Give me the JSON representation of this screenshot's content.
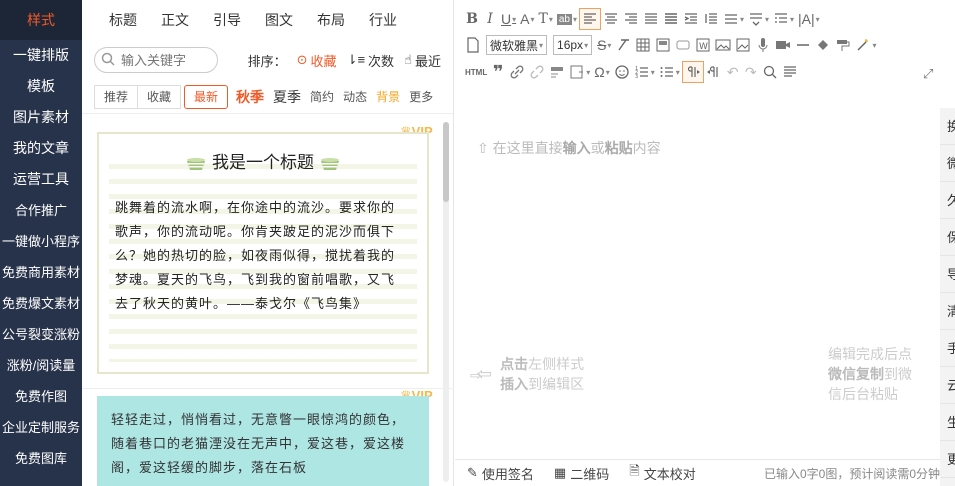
{
  "nav": {
    "items": [
      {
        "label": "样式"
      },
      {
        "label": "一键排版"
      },
      {
        "label": "模板"
      },
      {
        "label": "图片素材"
      },
      {
        "label": "我的文章"
      },
      {
        "label": "运营工具"
      },
      {
        "label": "合作推广"
      },
      {
        "label": "一键做小程序"
      },
      {
        "label": "免费商用素材"
      },
      {
        "label": "免费爆文素材"
      },
      {
        "label": "公号裂变涨粉"
      },
      {
        "label": "涨粉/阅读量"
      },
      {
        "label": "免费作图"
      },
      {
        "label": "企业定制服务"
      },
      {
        "label": "免费图库"
      }
    ]
  },
  "panel": {
    "tabs": [
      "标题",
      "正文",
      "引导",
      "图文",
      "布局",
      "行业"
    ],
    "search_placeholder": "输入关键字",
    "sort_label": "排序：",
    "sort_options": [
      "收藏",
      "次数",
      "最近"
    ],
    "filters": [
      "推荐",
      "收藏",
      "最新"
    ],
    "tags": [
      "秋季",
      "夏季",
      "简约",
      "动态",
      "背景",
      "更多"
    ],
    "card1": {
      "vip": "VIP",
      "title": "我是一个标题",
      "poem": "跳舞着的流水啊，在你途中的流沙。要求你的歌声，你的流动呢。你肯夹跛足的泥沙而俱下么？她的热切的脸，如夜雨似得，搅扰着我的梦魂。夏天的飞鸟，飞到我的窗前唱歌，又飞去了秋天的黄叶。——泰戈尔《飞鸟集》"
    },
    "card2": {
      "vip": "VIP",
      "text": "轻轻走过，悄悄看过，无意瞥一眼惊鸿的颜色，随着巷口的老猫湮没在无声中，爱这巷，爱这楼阁，爱这轻缓的脚步，落在石板"
    }
  },
  "editor": {
    "font_family": "微软雅黑",
    "font_size": "16px",
    "placeholder_pre": "在这里直接",
    "placeholder_b1": "输入",
    "placeholder_mid": "或",
    "placeholder_b2": "粘贴",
    "placeholder_post": "内容",
    "hint_left_b1": "点击",
    "hint_left_t1": "左侧样式",
    "hint_left_b2": "插入",
    "hint_left_t2": "到编辑区",
    "hint_right_t1": "编辑完成后点",
    "hint_right_b1": "微信复制",
    "hint_right_t2": "到微",
    "hint_right_t3": "信后台粘贴",
    "status": {
      "signature": "使用签名",
      "qrcode": "二维码",
      "proofread": "文本校对",
      "counter": "已输入0字0图，预计阅读需0分钟"
    }
  },
  "right_strip": {
    "items": [
      "换",
      "微",
      "久",
      "保",
      "导",
      "清",
      "手",
      "云",
      "生",
      "更"
    ]
  },
  "colors": {
    "accent": "#f05a28",
    "nav_bg": "#27334a",
    "vip": "#f5b84a",
    "card2_bg": "#aee6e4"
  }
}
